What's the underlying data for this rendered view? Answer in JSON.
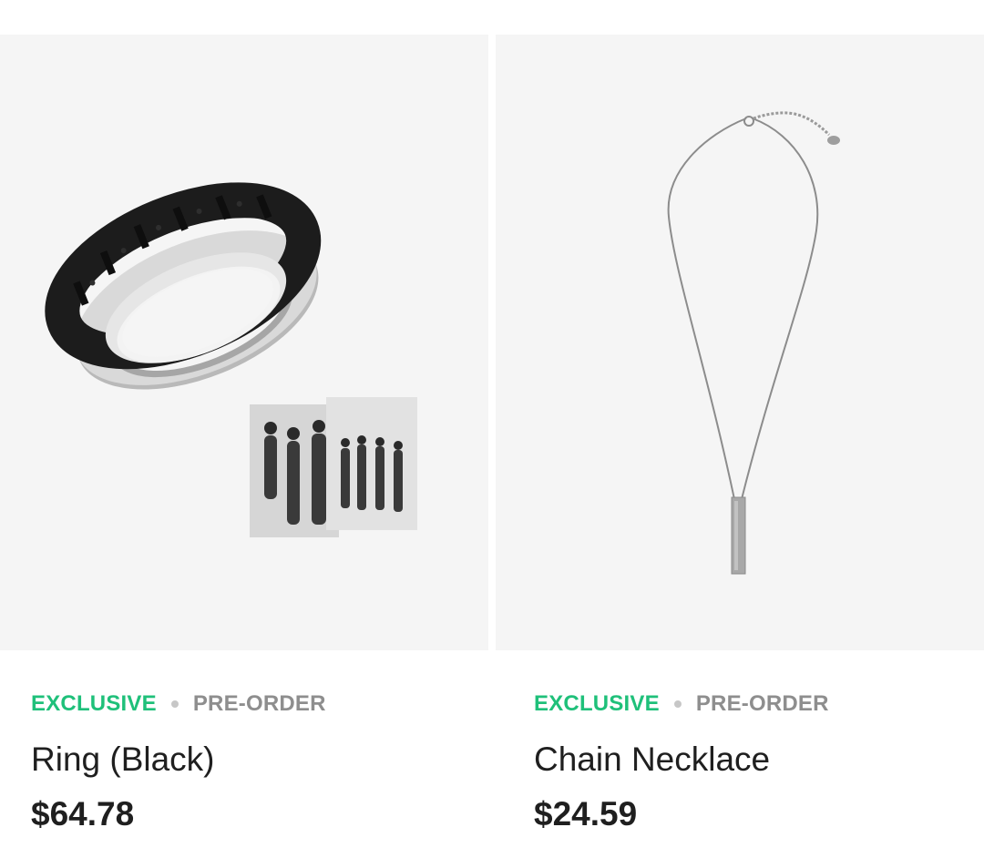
{
  "products": [
    {
      "badge_exclusive": "EXCLUSIVE",
      "badge_preorder": "PRE-ORDER",
      "name": "Ring (Black)",
      "price": "$64.78",
      "image": "ring-with-photocards"
    },
    {
      "badge_exclusive": "EXCLUSIVE",
      "badge_preorder": "PRE-ORDER",
      "name": "Chain Necklace",
      "price": "$24.59",
      "image": "bar-pendant-necklace"
    }
  ],
  "colors": {
    "exclusive": "#1fc07a",
    "preorder": "#8e8e8e",
    "image_bg": "#f5f5f5",
    "text": "#1f1f1f"
  }
}
